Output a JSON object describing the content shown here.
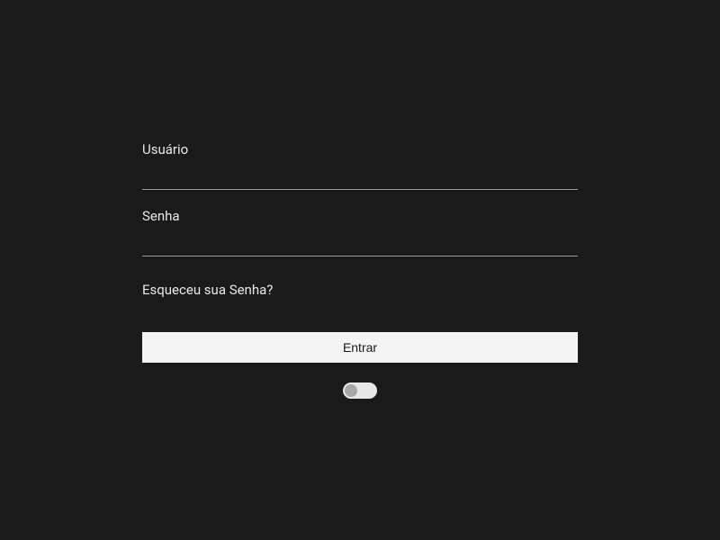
{
  "login": {
    "username_label": "Usuário",
    "username_value": "",
    "password_label": "Senha",
    "password_value": "",
    "forgot_link": "Esqueceu sua Senha?",
    "submit_label": "Entrar",
    "toggle_state": false
  }
}
